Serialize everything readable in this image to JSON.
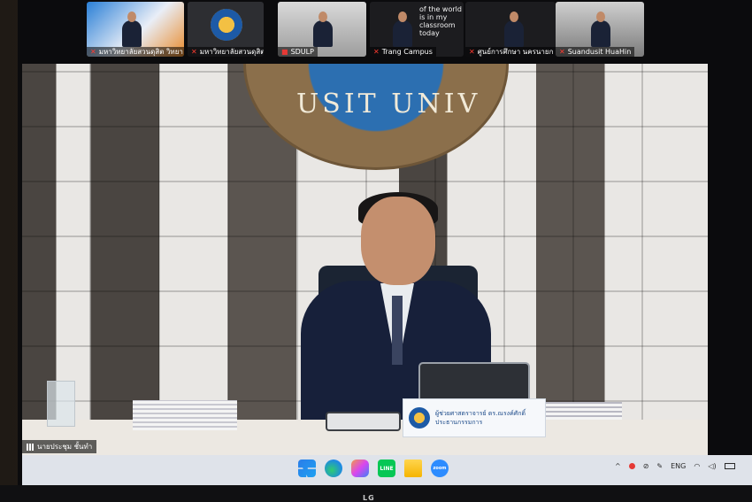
{
  "gallery": [
    {
      "name": "มหาวิทยาลัยสวนดุสิต วิทยา",
      "muted": true
    },
    {
      "name": "มหาวิทยาลัยสวนดุสิต",
      "muted": true
    },
    {
      "name": "SDULP",
      "muted": false
    },
    {
      "name": "Trang Campus",
      "muted": true
    },
    {
      "name": "ศูนย์การศึกษา นครนายก",
      "muted": true
    },
    {
      "name": "Suandusit HuaHin",
      "muted": true
    }
  ],
  "gallery_slide_text": "of the world\nis in my\nclassroom\ntoday",
  "backdrop_text": "USIT UNIV",
  "nameplate_text": "ผู้ช่วยศาสตราจารย์ ดร.ณรงค์ศักดิ์\nประธานกรรมการ",
  "active_speaker": "นายประชุม ชั้นทำ",
  "taskbar": {
    "apps": [
      {
        "name": "start-icon"
      },
      {
        "name": "edge-icon"
      },
      {
        "name": "copilot-icon"
      },
      {
        "name": "line-icon",
        "label": "LINE"
      },
      {
        "name": "file-explorer-icon"
      },
      {
        "name": "zoom-icon",
        "label": "zoom"
      }
    ],
    "tray": {
      "chevron": "^",
      "language": "ENG"
    }
  },
  "monitor_brand": "LG",
  "colors": {
    "muted": "#ff3b30",
    "zoom": "#2d8cff",
    "taskbar": "#dfe3ea"
  }
}
